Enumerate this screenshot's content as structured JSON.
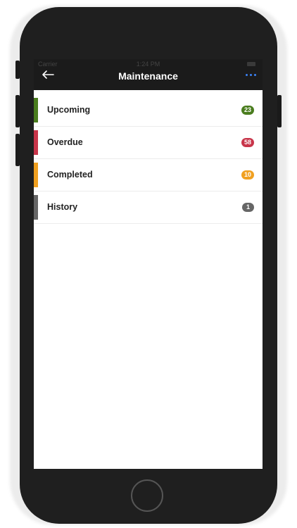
{
  "status_bar": {
    "carrier": "Carrier",
    "time": "1:24 PM"
  },
  "header": {
    "title": "Maintenance",
    "back_icon": "arrow-left-icon",
    "more_icon": "more-horizontal-icon"
  },
  "list": {
    "items": [
      {
        "label": "Upcoming",
        "count": "23",
        "color": "#4a7d1e"
      },
      {
        "label": "Overdue",
        "count": "58",
        "color": "#c8354a"
      },
      {
        "label": "Completed",
        "count": "10",
        "color": "#f0a020"
      },
      {
        "label": "History",
        "count": "1",
        "color": "#666666"
      }
    ]
  },
  "device": {
    "home_button_icon": "home-button"
  }
}
